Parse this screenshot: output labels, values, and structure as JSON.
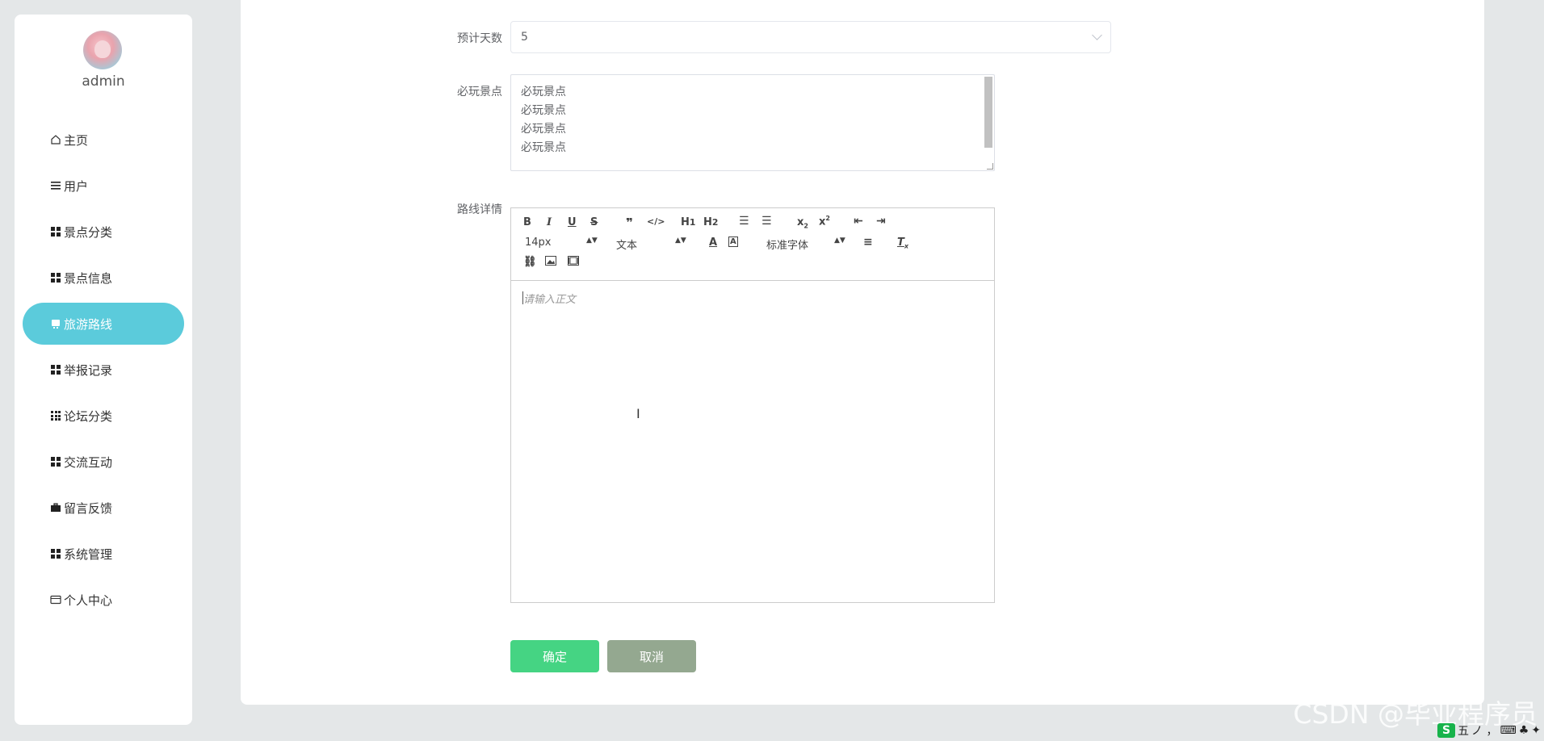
{
  "sidebar": {
    "username": "admin",
    "items": [
      {
        "label": "主页",
        "icon": "home-icon"
      },
      {
        "label": "用户",
        "icon": "list-icon"
      },
      {
        "label": "景点分类",
        "icon": "grid-icon"
      },
      {
        "label": "景点信息",
        "icon": "grid-icon"
      },
      {
        "label": "旅游路线",
        "icon": "grid-icon",
        "active": true
      },
      {
        "label": "举报记录",
        "icon": "grid-icon"
      },
      {
        "label": "论坛分类",
        "icon": "apps-icon"
      },
      {
        "label": "交流互动",
        "icon": "grid-icon"
      },
      {
        "label": "留言反馈",
        "icon": "briefcase-icon"
      },
      {
        "label": "系统管理",
        "icon": "grid-icon"
      },
      {
        "label": "个人中心",
        "icon": "card-icon"
      }
    ]
  },
  "form": {
    "days_label": "预计天数",
    "days_value": "5",
    "spots_label": "必玩景点",
    "spots_lines": [
      "必玩景点",
      "必玩景点",
      "必玩景点",
      "必玩景点"
    ],
    "detail_label": "路线详情",
    "editor": {
      "font_size": "14px",
      "header_picker": "文本",
      "font_picker": "标准字体",
      "placeholder": "请输入正文"
    },
    "ok_label": "确定",
    "cancel_label": "取消"
  },
  "watermark": "CSDN @毕业程序员",
  "tray": {
    "logo": "S",
    "ime": "五",
    "chars": "ノ ，"
  }
}
